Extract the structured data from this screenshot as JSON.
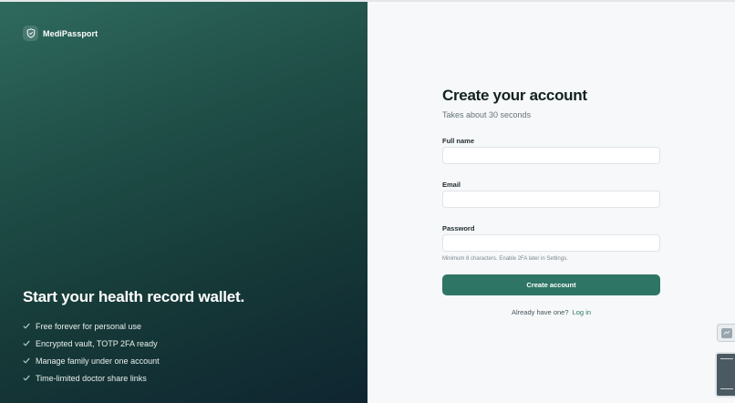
{
  "brand": {
    "name": "MediPassport",
    "icon": "shield-icon"
  },
  "hero": {
    "headline": "Start your health record wallet.",
    "features": [
      "Free forever for personal use",
      "Encrypted vault, TOTP 2FA ready",
      "Manage family under one account",
      "Time-limited doctor share links"
    ]
  },
  "form": {
    "title": "Create your account",
    "subtitle": "Takes about 30 seconds",
    "full_name": {
      "label": "Full name",
      "value": "",
      "placeholder": ""
    },
    "email": {
      "label": "Email",
      "value": "",
      "placeholder": ""
    },
    "password": {
      "label": "Password",
      "value": "",
      "placeholder": ""
    },
    "password_hint": "Minimum 8 characters. Enable 2FA later in Settings.",
    "submit_label": "Create account",
    "login_prompt": "Already have one?",
    "login_link": "Log in"
  },
  "colors": {
    "accent": "#2f7565",
    "panel_dark": "#163a38",
    "panel_light": "#f6f8f9"
  }
}
